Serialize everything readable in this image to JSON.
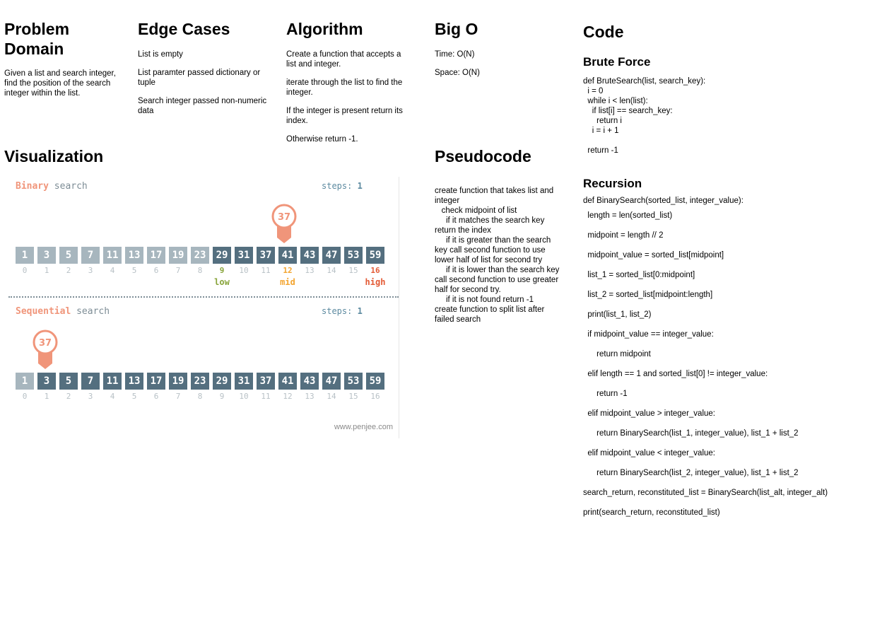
{
  "problem": {
    "title": "Problem Domain",
    "text": "Given a list and search integer, find the position of the search integer within the list."
  },
  "edge": {
    "title": "Edge Cases",
    "items": [
      "List is empty",
      "List paramter passed dictionary or tuple",
      "Search integer passed non-numeric data"
    ]
  },
  "algorithm": {
    "title": "Algorithm",
    "items": [
      "Create a function that accepts a list and integer.",
      "iterate through the list to find the integer.",
      "If the integer is present return its index.",
      "Otherwise return -1."
    ]
  },
  "bigo": {
    "title": "Big O",
    "time": "Time: O(N)",
    "space": "Space: O(N)"
  },
  "visualization": {
    "title": "Visualization",
    "binary_word": "Binary",
    "sequential_word": "Sequential",
    "search_word": "search",
    "steps_label": "steps:",
    "steps_value": "1",
    "values": [
      1,
      3,
      5,
      7,
      11,
      13,
      17,
      19,
      23,
      29,
      31,
      37,
      41,
      43,
      47,
      53,
      59
    ],
    "target": "37",
    "low_label": "low",
    "mid_label": "mid",
    "high_label": "high",
    "low_index": 9,
    "mid_index": 12,
    "high_index": 16,
    "sequential_current": 1,
    "credit": "www.penjee.com",
    "colors": {
      "accent": "#f0957a",
      "cell": "#546f7f",
      "cell_dim": "#a7b6be",
      "low": "#88a43a",
      "mid": "#f3a530",
      "high": "#e35a35"
    }
  },
  "pseudocode": {
    "title": "Pseudocode",
    "text": "create function that takes list and integer\n   check midpoint of list\n     if it matches the search key return the index\n     if it is greater than the search key call second function to use lower half of list for second try\n     if it is lower than the search key\ncall second function to use greater half for second try.\n     if it is not found return -1\ncreate function to split list after failed search"
  },
  "code": {
    "title": "Code",
    "brute_title": "Brute Force",
    "brute": "def BruteSearch(list, search_key):\n  i = 0\n  while i < len(list):\n    if list[i] == search_key:\n      return i\n    i = i + 1\n\n  return -1",
    "recursion_title": "Recursion",
    "recursion_head": "def BinarySearch(sorted_list, integer_value):",
    "recursion_lines": [
      "  length = len(sorted_list)",
      "  midpoint = length // 2",
      "  midpoint_value = sorted_list[midpoint]",
      "  list_1 = sorted_list[0:midpoint]",
      "  list_2 = sorted_list[midpoint:length]",
      "",
      "  print(list_1, list_2)",
      "",
      "  if midpoint_value == integer_value:",
      "      return midpoint",
      "  elif length == 1 and sorted_list[0] != integer_value:",
      "      return -1",
      "  elif midpoint_value > integer_value:",
      "      return BinarySearch(list_1, integer_value), list_1 + list_2",
      "  elif midpoint_value < integer_value:",
      "      return BinarySearch(list_2, integer_value), list_1 + list_2",
      "",
      "search_return, reconstituted_list = BinarySearch(list_alt, integer_alt)",
      "print(search_return, reconstituted_list)"
    ]
  }
}
